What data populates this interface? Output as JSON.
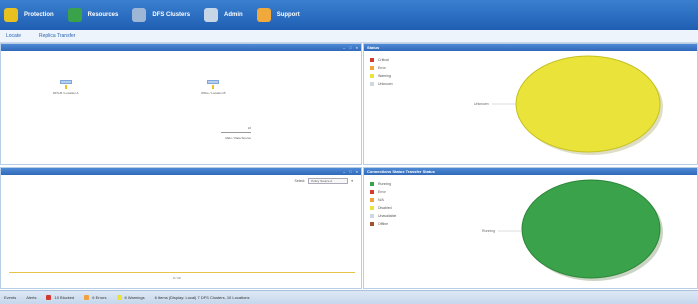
{
  "nav": [
    {
      "label": "Protection",
      "icon": "shield-icon",
      "color": "#e8c020"
    },
    {
      "label": "Resources",
      "icon": "server-icon",
      "color": "#3aa24a"
    },
    {
      "label": "DFS Clusters",
      "icon": "cluster-icon",
      "color": "#9fb7d6"
    },
    {
      "label": "Admin",
      "icon": "gears-icon",
      "color": "#c7d6e6"
    },
    {
      "label": "Support",
      "icon": "lifebuoy-icon",
      "color": "#f2a93b"
    }
  ],
  "subnav": [
    "Locate",
    "Replica Transfer"
  ],
  "topology": {
    "nodes": [
      {
        "label": "DFS-B / Location A"
      },
      {
        "label": "Office / Location B"
      },
      {
        "label": "Main / Data Source",
        "count": "10"
      }
    ]
  },
  "panels": {
    "status": {
      "title": "Status",
      "legend": [
        {
          "label": "Critical",
          "color": "#d43a2f"
        },
        {
          "label": "Error",
          "color": "#f2a23b"
        },
        {
          "label": "Warning",
          "color": "#e9e33a"
        },
        {
          "label": "Unknown",
          "color": "#cfd8e2"
        }
      ],
      "pie_label": "Unknown"
    },
    "transfer": {
      "title": "Connections Status Transfer Status",
      "legend": [
        {
          "label": "Running",
          "color": "#3aa24a"
        },
        {
          "label": "Error",
          "color": "#d43a2f"
        },
        {
          "label": "N/A",
          "color": "#f2a23b"
        },
        {
          "label": "Disabled",
          "color": "#e9e33a"
        },
        {
          "label": "Unavailable",
          "color": "#cfd8e2"
        },
        {
          "label": "Offline",
          "color": "#a0522d"
        }
      ],
      "pie_label": "Running"
    },
    "bottom_left": {
      "select_label": "Select:",
      "select_value": "Policy Source A",
      "footer_value": "0 / 10"
    }
  },
  "statusbar": [
    {
      "label": "Events",
      "color": ""
    },
    {
      "label": "Alerts",
      "color": ""
    },
    {
      "label": "10 Blocked",
      "color": "#d43a2f"
    },
    {
      "label": "6 Errors",
      "color": "#f2a23b"
    },
    {
      "label": "6 Warnings",
      "color": "#e9e33a"
    },
    {
      "label": "6 Items (Display: Local) 7 DFS Clusters, 10 Locations",
      "color": ""
    }
  ],
  "chart_data": [
    {
      "type": "pie",
      "title": "Status",
      "categories": [
        "Critical",
        "Error",
        "Warning",
        "Unknown"
      ],
      "values": [
        0,
        0,
        100,
        0
      ]
    },
    {
      "type": "pie",
      "title": "Connections Status Transfer Status",
      "categories": [
        "Running",
        "Error",
        "N/A",
        "Disabled",
        "Unavailable",
        "Offline"
      ],
      "values": [
        100,
        0,
        0,
        0,
        0,
        0
      ]
    }
  ]
}
